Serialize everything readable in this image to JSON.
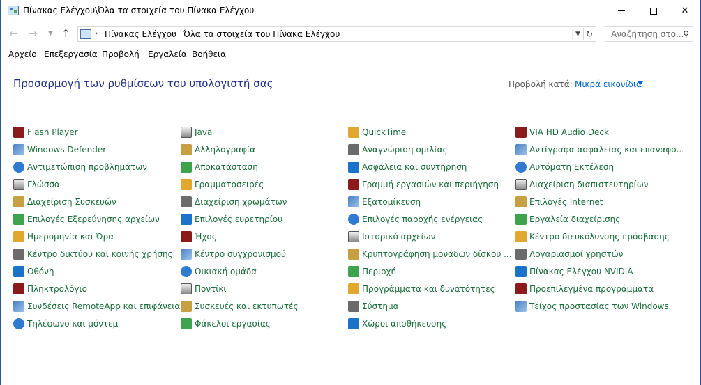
{
  "window": {
    "title": "Πίνακας Ελέγχου\\Όλα τα στοιχεία του Πίνακα Ελέγχου"
  },
  "nav": {
    "breadcrumbs": [
      "Πίνακας Ελέγχου",
      "Όλα τα στοιχεία του Πίνακα Ελέγχου"
    ],
    "search_placeholder": "Αναζήτηση στο..."
  },
  "menu": {
    "items": [
      "Αρχείο",
      "Επεξεργασία",
      "Προβολή",
      "Εργαλεία",
      "Βοήθεια"
    ]
  },
  "header": {
    "title": "Προσαρμογή των ρυθμίσεων του υπολογιστή σας",
    "view_by_label": "Προβολή κατά:",
    "view_by_value": "Μικρά εικονίδια"
  },
  "columns": [
    [
      {
        "label": "Flash Player",
        "icon": "flash-player-icon"
      },
      {
        "label": "Windows Defender",
        "icon": "windows-defender-icon"
      },
      {
        "label": "Αντιμετώπιση προβλημάτων",
        "icon": "troubleshooting-icon"
      },
      {
        "label": "Γλώσσα",
        "icon": "language-icon"
      },
      {
        "label": "Διαχείριση Συσκευών",
        "icon": "device-manager-icon"
      },
      {
        "label": "Επιλογές Εξερεύνησης αρχείων",
        "icon": "file-explorer-options-icon"
      },
      {
        "label": "Ημερομηνία και Ώρα",
        "icon": "date-time-icon"
      },
      {
        "label": "Κέντρο δικτύου και κοινής χρήσης",
        "icon": "network-sharing-icon"
      },
      {
        "label": "Οθόνη",
        "icon": "display-icon"
      },
      {
        "label": "Πληκτρολόγιο",
        "icon": "keyboard-icon"
      },
      {
        "label": "Συνδέσεις RemoteApp και επιφάνεια...",
        "icon": "remoteapp-icon"
      },
      {
        "label": "Τηλέφωνο και μόντεμ",
        "icon": "phone-modem-icon"
      }
    ],
    [
      {
        "label": "Java",
        "icon": "java-icon"
      },
      {
        "label": "Αλληλογραφία",
        "icon": "mail-icon"
      },
      {
        "label": "Αποκατάσταση",
        "icon": "recovery-icon"
      },
      {
        "label": "Γραμματοσειρές",
        "icon": "fonts-icon"
      },
      {
        "label": "Διαχείριση χρωμάτων",
        "icon": "color-management-icon"
      },
      {
        "label": "Επιλογές ευρετηρίου",
        "icon": "indexing-options-icon"
      },
      {
        "label": "Ήχος",
        "icon": "sound-icon"
      },
      {
        "label": "Κέντρο συγχρονισμού",
        "icon": "sync-center-icon"
      },
      {
        "label": "Οικιακή ομάδα",
        "icon": "homegroup-icon"
      },
      {
        "label": "Ποντίκι",
        "icon": "mouse-icon"
      },
      {
        "label": "Συσκευές και εκτυπωτές",
        "icon": "devices-printers-icon"
      },
      {
        "label": "Φάκελοι εργασίας",
        "icon": "work-folders-icon"
      }
    ],
    [
      {
        "label": "QuickTime",
        "icon": "quicktime-icon"
      },
      {
        "label": "Αναγνώριση ομιλίας",
        "icon": "speech-recognition-icon"
      },
      {
        "label": "Ασφάλεια και συντήρηση",
        "icon": "security-maintenance-icon"
      },
      {
        "label": "Γραμμή εργασιών και περιήγηση",
        "icon": "taskbar-navigation-icon"
      },
      {
        "label": "Εξατομίκευση",
        "icon": "personalization-icon"
      },
      {
        "label": "Επιλογές παροχής ενέργειας",
        "icon": "power-options-icon"
      },
      {
        "label": "Ιστορικό αρχείων",
        "icon": "file-history-icon"
      },
      {
        "label": "Κρυπτογράφηση μονάδων δίσκου ...",
        "icon": "bitlocker-icon"
      },
      {
        "label": "Περιοχή",
        "icon": "region-icon"
      },
      {
        "label": "Προγράμματα και δυνατότητες",
        "icon": "programs-features-icon"
      },
      {
        "label": "Σύστημα",
        "icon": "system-icon"
      },
      {
        "label": "Χώροι αποθήκευσης",
        "icon": "storage-spaces-icon"
      }
    ],
    [
      {
        "label": "VIA HD Audio Deck",
        "icon": "via-audio-icon"
      },
      {
        "label": "Αντίγραφα ασφαλείας και επαναφο...",
        "icon": "backup-restore-icon"
      },
      {
        "label": "Αυτόματη Εκτέλεση",
        "icon": "autoplay-icon"
      },
      {
        "label": "Διαχείριση διαπιστευτηρίων",
        "icon": "credential-manager-icon"
      },
      {
        "label": "Επιλογές Internet",
        "icon": "internet-options-icon"
      },
      {
        "label": "Εργαλεία διαχείρισης",
        "icon": "admin-tools-icon"
      },
      {
        "label": "Κέντρο διευκόλυνσης πρόσβασης",
        "icon": "ease-of-access-icon"
      },
      {
        "label": "Λογαριασμοί χρηστών",
        "icon": "user-accounts-icon"
      },
      {
        "label": "Πίνακας Ελέγχου NVIDIA",
        "icon": "nvidia-icon"
      },
      {
        "label": "Προεπιλεγμένα προγράμματα",
        "icon": "default-programs-icon"
      },
      {
        "label": "Τείχος προστασίας των Windows",
        "icon": "firewall-icon"
      }
    ]
  ],
  "colors": {
    "link_green": "#1a6d3a",
    "title_blue": "#1e3287",
    "accent_blue": "#0066cc"
  }
}
